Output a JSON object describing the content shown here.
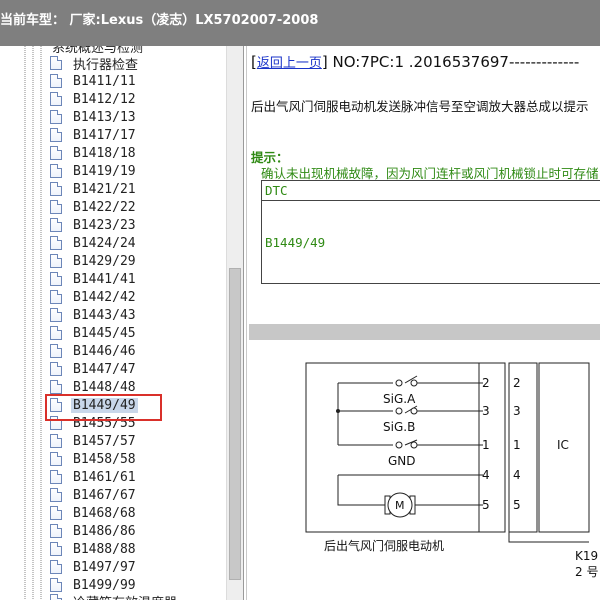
{
  "window": {
    "title": "当前车型： 厂家:Lexus（凌志）LX5702007-2008"
  },
  "tree": {
    "partial_top_label": "系统概述与检测",
    "items": [
      {
        "label": "执行器检查",
        "selected": false
      },
      {
        "label": "B1411/11",
        "selected": false
      },
      {
        "label": "B1412/12",
        "selected": false
      },
      {
        "label": "B1413/13",
        "selected": false
      },
      {
        "label": "B1417/17",
        "selected": false
      },
      {
        "label": "B1418/18",
        "selected": false
      },
      {
        "label": "B1419/19",
        "selected": false
      },
      {
        "label": "B1421/21",
        "selected": false
      },
      {
        "label": "B1422/22",
        "selected": false
      },
      {
        "label": "B1423/23",
        "selected": false
      },
      {
        "label": "B1424/24",
        "selected": false
      },
      {
        "label": "B1429/29",
        "selected": false
      },
      {
        "label": "B1441/41",
        "selected": false
      },
      {
        "label": "B1442/42",
        "selected": false
      },
      {
        "label": "B1443/43",
        "selected": false
      },
      {
        "label": "B1445/45",
        "selected": false
      },
      {
        "label": "B1446/46",
        "selected": false
      },
      {
        "label": "B1447/47",
        "selected": false
      },
      {
        "label": "B1448/48",
        "selected": false
      },
      {
        "label": "B1449/49",
        "selected": true
      },
      {
        "label": "B1455/55",
        "selected": false
      },
      {
        "label": "B1457/57",
        "selected": false
      },
      {
        "label": "B1458/58",
        "selected": false
      },
      {
        "label": "B1461/61",
        "selected": false
      },
      {
        "label": "B1467/67",
        "selected": false
      },
      {
        "label": "B1468/68",
        "selected": false
      },
      {
        "label": "B1486/86",
        "selected": false
      },
      {
        "label": "B1488/88",
        "selected": false
      },
      {
        "label": "B1497/97",
        "selected": false
      },
      {
        "label": "B1499/99",
        "selected": false
      }
    ],
    "partial_bottom_label": "冷藏箱有效温度器"
  },
  "content": {
    "back_link": "返回上一页",
    "doc_number": "NO:7PC:1 .2016537697-------------",
    "description": "后出气风门伺服电动机发送脉冲信号至空调放大器总成以提示",
    "hint_title": "提示：",
    "hint_text": "确认未出现机械故障，因为风门连杆或风门机械锁止时可存储",
    "dtc_header": "DTC",
    "dtc_code": "B1449/49"
  },
  "diagram": {
    "signals": [
      "SiG.A",
      "SiG.B",
      "GND"
    ],
    "motor_label": "M",
    "pins_left": [
      "2",
      "3",
      "1",
      "4",
      "5"
    ],
    "pins_right": [
      "2",
      "3",
      "1",
      "4",
      "5"
    ],
    "ic_label": "IC",
    "caption": "后出气风门伺服电动机",
    "connector_code": "K19",
    "connector_sub": "2 号"
  },
  "colors": {
    "titlebar": "#7f7f7f",
    "hint_green": "#2f8a14",
    "link_blue": "#1a33c9",
    "highlight_red": "#d9302a",
    "selection_bg": "#c9d7ea"
  }
}
